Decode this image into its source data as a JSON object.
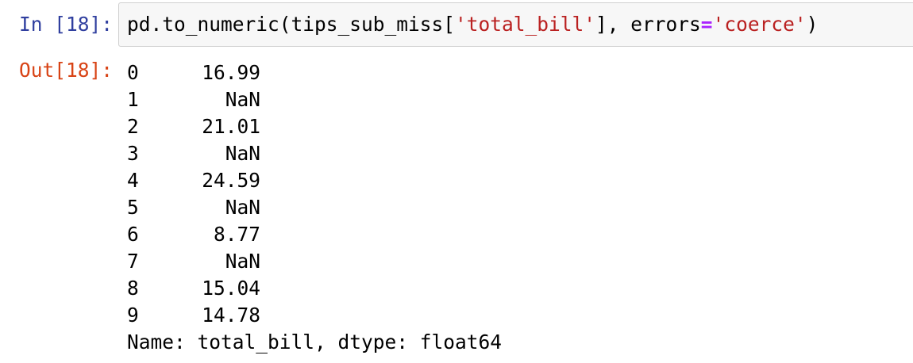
{
  "cell": {
    "in_prompt": "In [18]:",
    "out_prompt": "Out[18]:",
    "code": {
      "prefix": "pd.to_numeric(tips_sub_miss[",
      "arg_string": "'total_bill'",
      "mid": "], errors",
      "operator": "=",
      "kw_string": "'coerce'",
      "suffix": ")"
    }
  },
  "output": {
    "rows": [
      {
        "index": "0",
        "value": "16.99"
      },
      {
        "index": "1",
        "value": "NaN"
      },
      {
        "index": "2",
        "value": "21.01"
      },
      {
        "index": "3",
        "value": "NaN"
      },
      {
        "index": "4",
        "value": "24.59"
      },
      {
        "index": "5",
        "value": "NaN"
      },
      {
        "index": "6",
        "value": "8.77"
      },
      {
        "index": "7",
        "value": "NaN"
      },
      {
        "index": "8",
        "value": "15.04"
      },
      {
        "index": "9",
        "value": "14.78"
      }
    ],
    "footer": "Name: total_bill, dtype: float64"
  },
  "colors": {
    "in_prompt": "#303f9f",
    "out_prompt": "#d84315",
    "string": "#ba2121",
    "operator": "#aa22ff",
    "input_background": "#f7f7f7",
    "input_border": "#cfcfcf"
  }
}
